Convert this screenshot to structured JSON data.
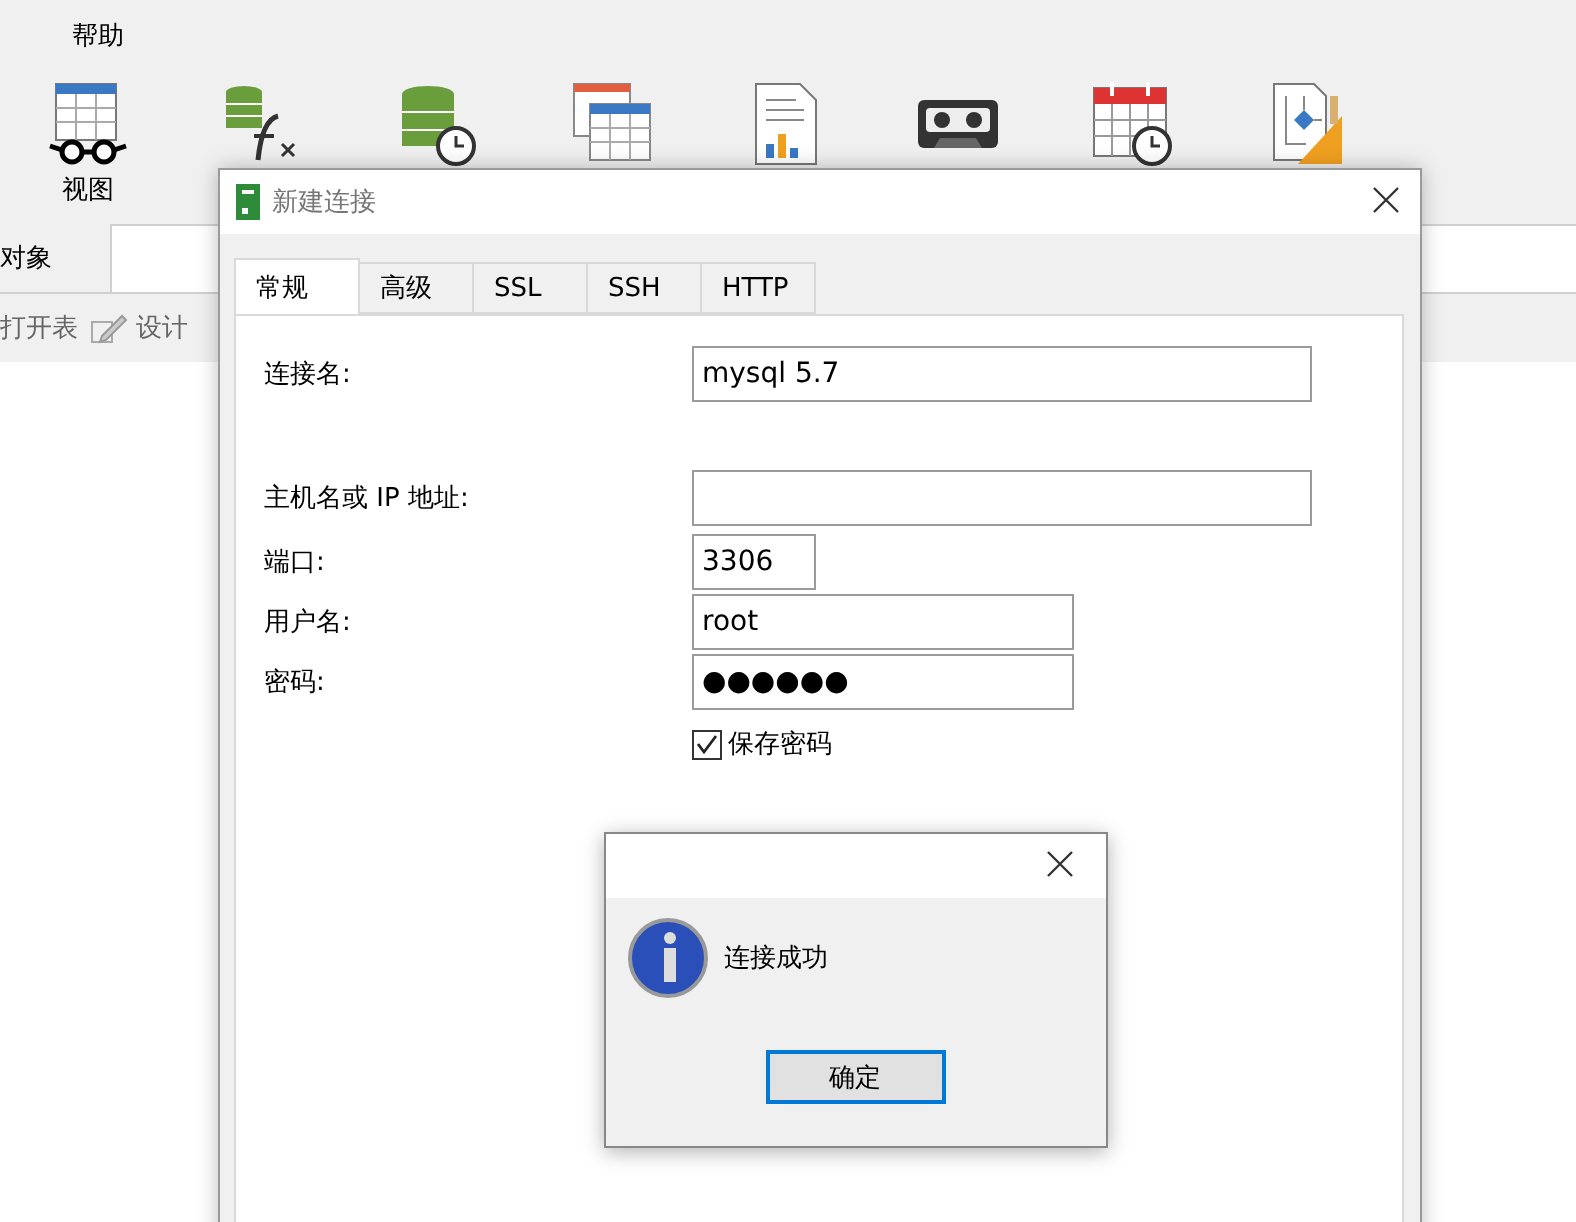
{
  "menu": [
    {
      "label": "帮助"
    }
  ],
  "toolbar": [
    {
      "kind": "view",
      "label": "视图"
    },
    {
      "kind": "function"
    },
    {
      "kind": "schedule"
    },
    {
      "kind": "tables"
    },
    {
      "kind": "report"
    },
    {
      "kind": "tape"
    },
    {
      "kind": "calendar"
    },
    {
      "kind": "model"
    }
  ],
  "object_tab": {
    "label": "对象"
  },
  "object_actions": [
    {
      "kind": "open",
      "label": "打开表"
    },
    {
      "kind": "design",
      "label": "设计"
    }
  ],
  "dialog": {
    "title": "新建连接",
    "tabs": [
      {
        "label": "常规",
        "selected": true
      },
      {
        "label": "高级",
        "selected": false
      },
      {
        "label": "SSL",
        "selected": false
      },
      {
        "label": "SSH",
        "selected": false
      },
      {
        "label": "HTTP",
        "selected": false
      }
    ],
    "fields": [
      {
        "kind": "name",
        "label": "连接名:",
        "value": "mysql 5.7"
      },
      {
        "kind": "host",
        "label": "主机名或 IP 地址:"
      },
      {
        "kind": "port",
        "label": "端口:",
        "value": "3306"
      },
      {
        "kind": "user",
        "label": "用户名:",
        "value": "root"
      },
      {
        "kind": "password",
        "label": "密码:",
        "value": "●●●●●●"
      }
    ],
    "save_password": {
      "label": "保存密码",
      "checked": true
    }
  },
  "message_box": {
    "message": "连接成功",
    "button": "确定"
  }
}
